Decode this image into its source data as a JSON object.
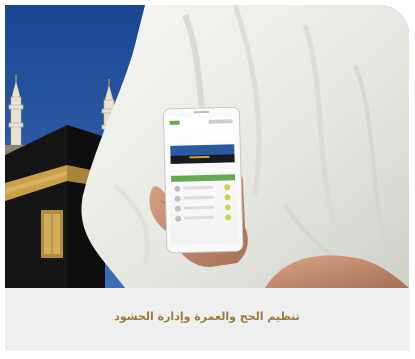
{
  "caption": {
    "text": "تنظيم الحج والعمرة وإدارة الحشود"
  },
  "colors": {
    "sky": "#1f4f96",
    "kaaba_black": "#151515",
    "kiswa_gold": "#c8a14a",
    "ihram_white": "#eeeeea",
    "skin": "#c99475",
    "caption_text": "#9c7a3a",
    "card_background": "#efefef",
    "app_header_green": "#6aa84f"
  },
  "scene": {
    "subject": "pilgrim-in-ihram-holding-phone",
    "background": "kaaba-with-minarets",
    "phone_screen": "mobile-app-list"
  }
}
